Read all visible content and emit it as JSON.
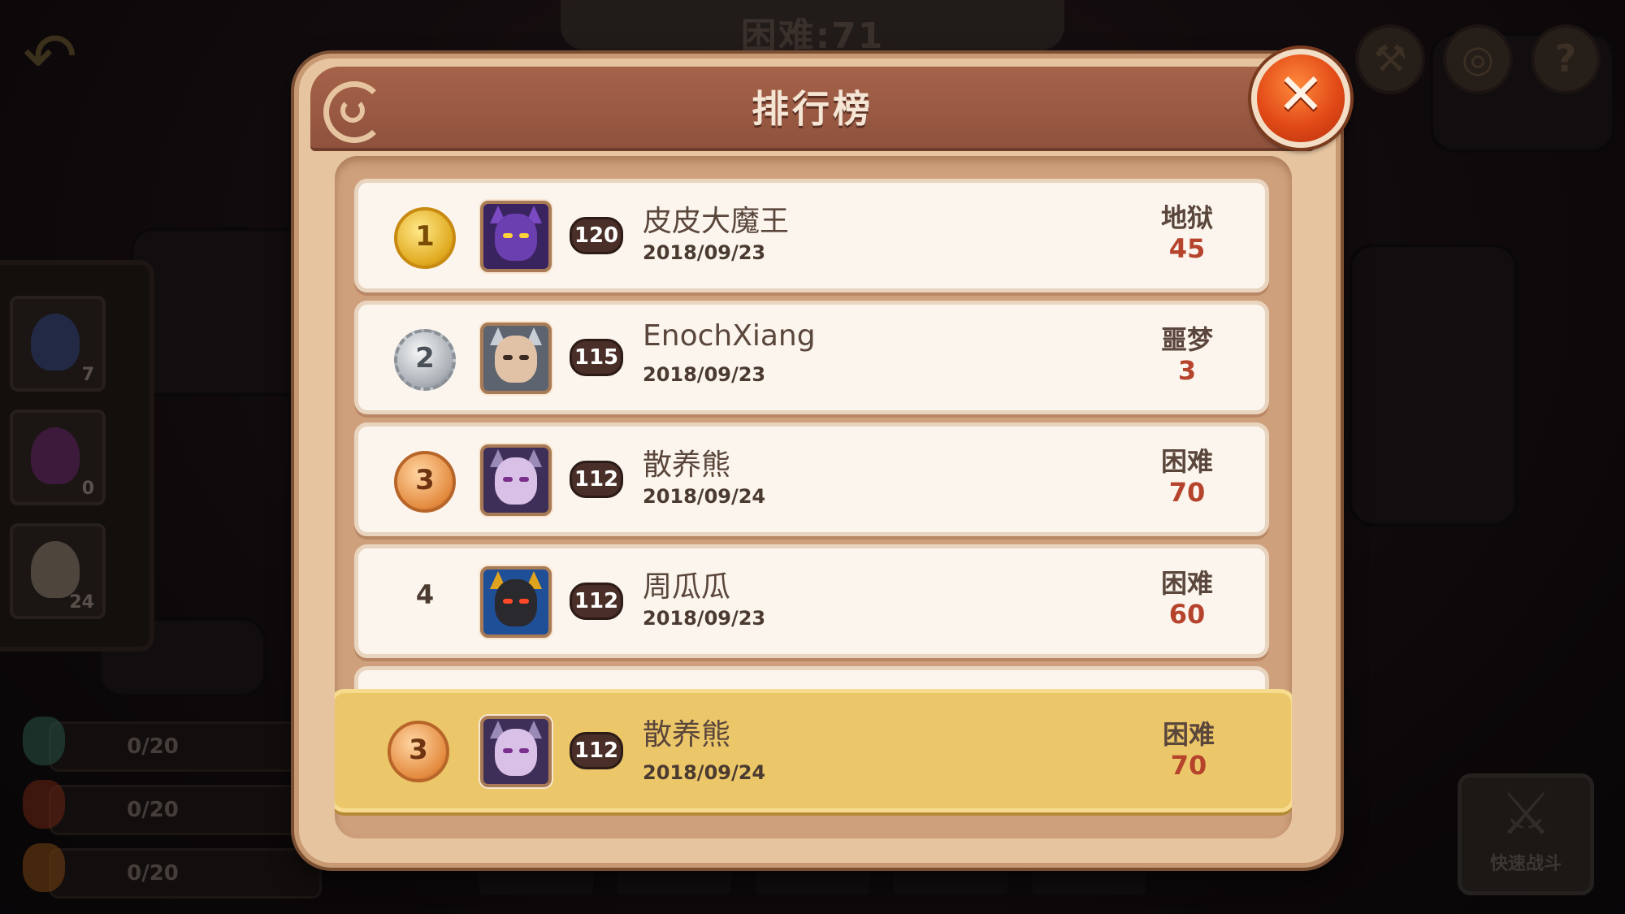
{
  "scene": {
    "top_title": "困难:71",
    "side_items": [
      {
        "icon": "potion-wing-icon",
        "count": "7"
      },
      {
        "icon": "demon-potion-icon",
        "count": "0"
      },
      {
        "icon": "jar-icon",
        "count": "24"
      }
    ],
    "resources": [
      {
        "icon": "green-potion-icon",
        "value": "0/20"
      },
      {
        "icon": "red-potion-icon",
        "value": "0/20"
      },
      {
        "icon": "orange-potion-icon",
        "value": "0/20"
      }
    ],
    "quick_battle_label": "快速战斗",
    "right_buttons": [
      {
        "icon": "hammer-icon",
        "glyph": "⚒"
      },
      {
        "icon": "medal-icon",
        "glyph": "◎"
      },
      {
        "icon": "help-icon",
        "glyph": "?"
      }
    ]
  },
  "leaderboard": {
    "title": "排行榜",
    "close_glyph": "✕",
    "rows": [
      {
        "rank": "1",
        "medal": "gold",
        "level": "120",
        "name": "皮皮大魔王",
        "date": "2018/09/23",
        "difficulty": "地狱",
        "stage": "45",
        "avatar": "purple-dragon"
      },
      {
        "rank": "2",
        "medal": "silver",
        "level": "115",
        "name": "EnochXiang",
        "date": "2018/09/23",
        "difficulty": "噩梦",
        "stage": "3",
        "avatar": "silver-knight"
      },
      {
        "rank": "3",
        "medal": "bronze",
        "level": "112",
        "name": "散养熊",
        "date": "2018/09/24",
        "difficulty": "困难",
        "stage": "70",
        "avatar": "violet-sorceress"
      },
      {
        "rank": "4",
        "medal": "",
        "level": "112",
        "name": "周瓜瓜",
        "date": "2018/09/23",
        "difficulty": "困难",
        "stage": "60",
        "avatar": "oni-mask"
      }
    ],
    "my_rank": {
      "rank": "3",
      "medal": "bronze",
      "level": "112",
      "name": "散养熊",
      "date": "2018/09/24",
      "difficulty": "困难",
      "stage": "70",
      "avatar": "violet-sorceress"
    }
  }
}
